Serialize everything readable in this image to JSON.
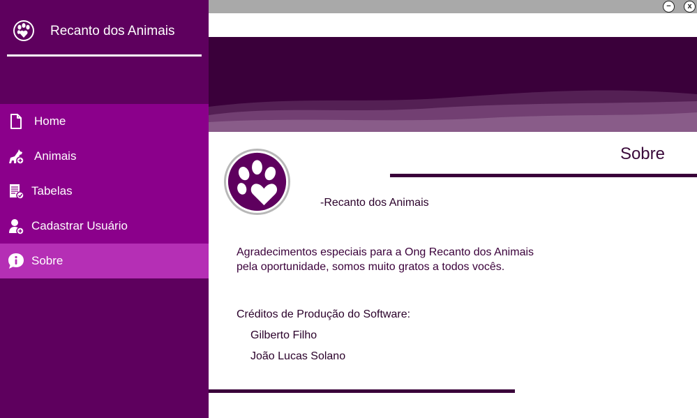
{
  "sidebar": {
    "brand_title": "Recanto dos Animais",
    "items": [
      {
        "label": "Home",
        "icon": "file-icon"
      },
      {
        "label": "Animais",
        "icon": "dog-add-icon"
      },
      {
        "label": "Tabelas",
        "icon": "table-check-icon"
      },
      {
        "label": "Cadastrar Usuário",
        "icon": "user-add-icon"
      },
      {
        "label": "Sobre",
        "icon": "info-icon"
      }
    ],
    "active_item": "Sobre"
  },
  "window": {
    "minimize_symbol": "−",
    "close_symbol": "x"
  },
  "content": {
    "title": "Sobre",
    "logo_caption": "-Recanto dos Animais",
    "thanks_line1": "Agradecimentos especiais para a Ong Recanto dos Animais",
    "thanks_line2": "pela oportunidade, somos muito gratos a todos vocês.",
    "credits_title": "Créditos de Produção do Software:",
    "credits": [
      "Gilberto Filho",
      "João Lucas Solano"
    ]
  },
  "colors": {
    "sidebar_bg": "#5e005e",
    "menu_bg": "#8b008b",
    "menu_active": "#b52fb5",
    "banner_bg": "#3a003a",
    "accent_line": "#3a003a"
  }
}
